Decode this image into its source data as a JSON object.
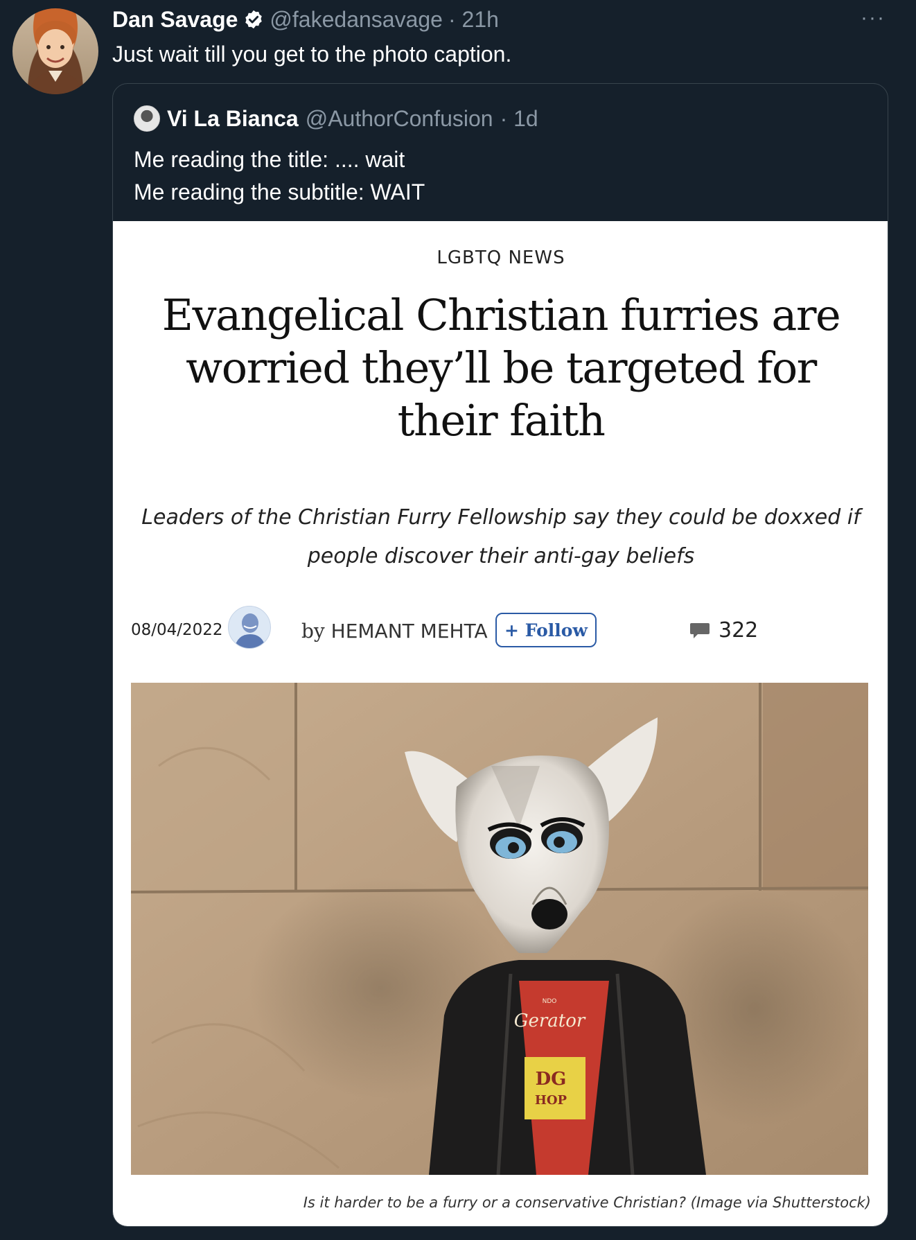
{
  "tweet": {
    "author_name": "Dan Savage",
    "author_handle": "@fakedansavage",
    "time": "· 21h",
    "text": "Just wait till you get to the photo caption.",
    "more": "···"
  },
  "quoted": {
    "author_name": "Vi La Bianca",
    "author_handle": "@AuthorConfusion",
    "time": "· 1d",
    "text_line1": "Me reading the title: .... wait",
    "text_line2": "Me reading the subtitle: WAIT"
  },
  "article": {
    "section": "LGBTQ NEWS",
    "headline": "Evangelical Christian furries are worried they’ll be targeted for their faith",
    "subtitle": "Leaders of the Christian Furry Fellowship say they could be doxxed if people discover their anti-gay beliefs",
    "date": "08/04/2022",
    "by_word": "by",
    "author": "HEMANT MEHTA",
    "follow_label": "+ Follow",
    "comment_count": "322",
    "shirt_brand": "Gerator",
    "shirt_small": "NDO",
    "shirt_bottom": "DG",
    "shirt_bottom2": "HOP",
    "caption": "Is it harder to be a furry or a conservative Christian? (Image via Shutterstock)"
  },
  "colors": {
    "background": "#15202b",
    "secondary_text": "#8b98a5",
    "verified_badge": "#ffffff",
    "follow_blue": "#2a5aa5"
  },
  "icons": [
    "verified-badge-icon",
    "more-options-icon",
    "comment-bubble-icon"
  ]
}
